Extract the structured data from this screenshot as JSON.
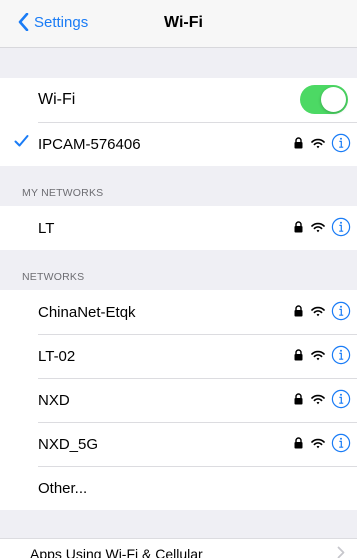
{
  "nav": {
    "back_label": "Settings",
    "title": "Wi-Fi"
  },
  "wifi": {
    "label": "Wi-Fi",
    "enabled": true,
    "connected_network": "IPCAM-576406"
  },
  "my_networks": {
    "header": "MY NETWORKS",
    "items": [
      {
        "name": "LT",
        "secured": true
      }
    ]
  },
  "networks": {
    "header": "NETWORKS",
    "items": [
      {
        "name": "ChinaNet-Etqk",
        "secured": true
      },
      {
        "name": "LT-02",
        "secured": true
      },
      {
        "name": "NXD",
        "secured": true
      },
      {
        "name": "NXD_5G",
        "secured": true
      }
    ],
    "other_label": "Other..."
  },
  "apps_row": {
    "label": "Apps Using Wi-Fi & Cellular"
  },
  "colors": {
    "accent": "#1a7cf6",
    "toggle_on": "#4cd964",
    "background": "#efeff4"
  }
}
